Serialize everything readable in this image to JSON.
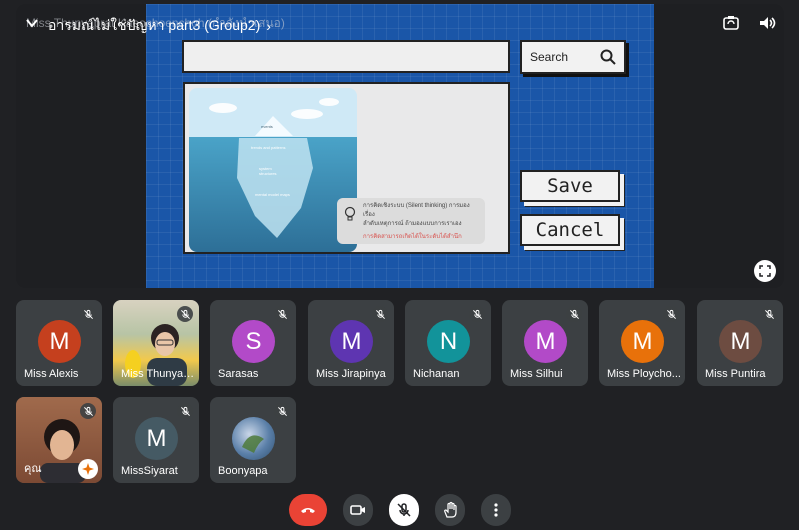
{
  "header": {
    "presenter_label": "Miss Thunyaprat Kaeochoenchoh (กำลังนำเสนอ)",
    "meeting_title": "อารมณ์ไม่ใช่ปัญหา part3 (Group2)",
    "meeting_title_chevron": "›"
  },
  "slide": {
    "search_label": "Search",
    "save_label": "Save",
    "cancel_label": "Cancel",
    "iceberg_labels": [
      "events",
      "trends and patterns",
      "system structures",
      "mental model maps"
    ],
    "tooltip_line1": "การคิดเชิงระบบ (Silent thinking) การมองเรื่อง",
    "tooltip_line2": "ลำดับเหตุการณ์ ถ้ามองแบบการเราเอง",
    "tooltip_line3": "การคิดสามารถเกิดได้ในระดับได้สำนึก"
  },
  "participants": [
    {
      "name": "Miss Alexis",
      "initial": "M",
      "color": "#c5401e",
      "type": "avatar"
    },
    {
      "name": "Miss Thunyap...",
      "initial": "",
      "color": "#6b8a6a",
      "type": "video"
    },
    {
      "name": "Sarasas",
      "initial": "S",
      "color": "#b24ac8",
      "type": "avatar"
    },
    {
      "name": "Miss Jirapinya",
      "initial": "M",
      "color": "#5e35b1",
      "type": "avatar"
    },
    {
      "name": "Nichanan",
      "initial": "N",
      "color": "#12939a",
      "type": "avatar"
    },
    {
      "name": "Miss Silhui",
      "initial": "M",
      "color": "#b24ac8",
      "type": "avatar"
    },
    {
      "name": "Miss Ploycho...",
      "initial": "M",
      "color": "#e8710a",
      "type": "avatar"
    },
    {
      "name": "Miss Puntira",
      "initial": "M",
      "color": "#6d4c41",
      "type": "avatar"
    },
    {
      "name": "คุณ",
      "initial": "",
      "color": "#8a5a44",
      "type": "video-self"
    },
    {
      "name": "MissSiyarat",
      "initial": "M",
      "color": "#455a64",
      "type": "avatar"
    },
    {
      "name": "Boonyapa",
      "initial": "",
      "color": "#5a7fa8",
      "type": "photo"
    }
  ],
  "controls": {
    "end_call_color": "#ea4335",
    "icons": [
      "end-call-icon",
      "camera-icon",
      "mic-off-icon",
      "raise-hand-icon",
      "more-vert-icon"
    ]
  }
}
